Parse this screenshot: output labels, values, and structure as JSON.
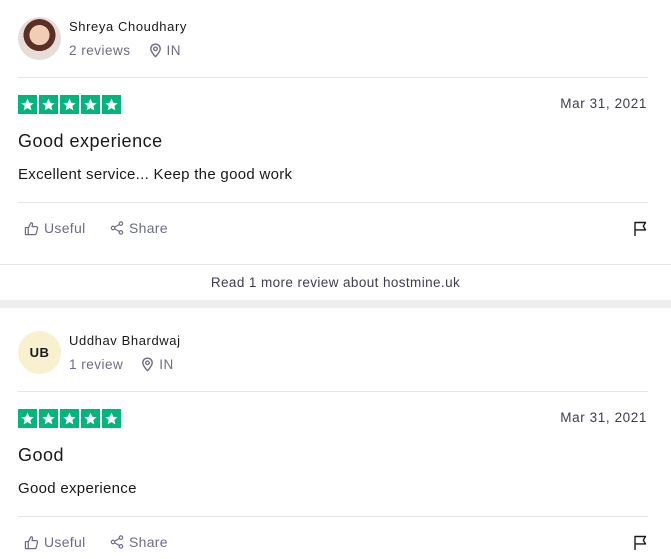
{
  "reviews": [
    {
      "reviewer_name": "Shreya Choudhary",
      "review_count": "2 reviews",
      "country": "IN",
      "avatar_type": "photo",
      "rating": 5,
      "date": "Mar 31, 2021",
      "title": "Good experience",
      "body": "Excellent service... Keep the good work",
      "useful_label": "Useful",
      "share_label": "Share"
    },
    {
      "reviewer_name": "Uddhav Bhardwaj",
      "review_count": "1 review",
      "country": "IN",
      "avatar_type": "initials",
      "initials": "UB",
      "rating": 5,
      "date": "Mar 31, 2021",
      "title": "Good",
      "body": "Good experience",
      "useful_label": "Useful",
      "share_label": "Share"
    }
  ],
  "read_more": {
    "label": "Read 1 more review about hostmine.uk"
  },
  "colors": {
    "star_green": "#00b67a",
    "muted_text": "#6c6c85",
    "initials_bg": "#f8f0cf"
  },
  "icons": {
    "location": "location-pin-icon",
    "useful": "thumbs-up-icon",
    "share": "share-icon",
    "report": "flag-icon",
    "star": "star-icon"
  }
}
